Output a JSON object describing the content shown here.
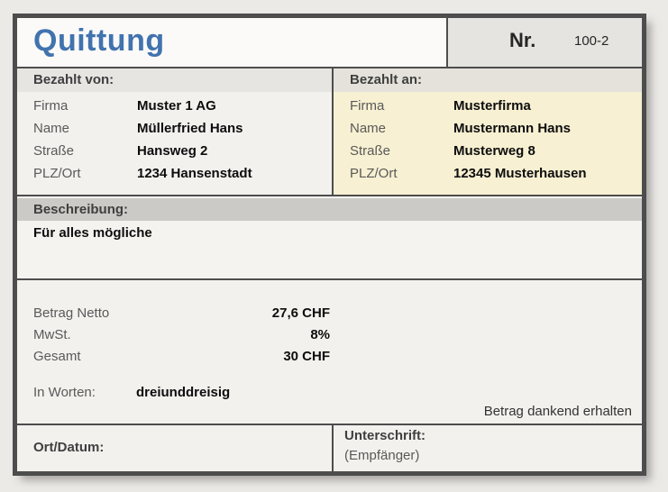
{
  "title": "Quittung",
  "number": {
    "label": "Nr.",
    "value": "100-2"
  },
  "paid_from": {
    "header": "Bezahlt von:",
    "fields": [
      {
        "label": "Firma",
        "value": "Muster 1 AG"
      },
      {
        "label": "Name",
        "value": "Müllerfried Hans"
      },
      {
        "label": "Straße",
        "value": "Hansweg 2"
      },
      {
        "label": "PLZ/Ort",
        "value": "1234 Hansenstadt"
      }
    ]
  },
  "paid_to": {
    "header": "Bezahlt an:",
    "fields": [
      {
        "label": "Firma",
        "value": "Musterfirma"
      },
      {
        "label": "Name",
        "value": "Mustermann Hans"
      },
      {
        "label": "Straße",
        "value": "Musterweg 8"
      },
      {
        "label": "PLZ/Ort",
        "value": "12345 Musterhausen"
      }
    ]
  },
  "description": {
    "header": "Beschreibung:",
    "text": "Für alles mögliche"
  },
  "amounts": {
    "net": {
      "label": "Betrag Netto",
      "value": "27,6 CHF"
    },
    "vat": {
      "label": "MwSt.",
      "value": "8%"
    },
    "total": {
      "label": "Gesamt",
      "value": "30 CHF"
    },
    "in_words": {
      "label": "In Worten:",
      "value": "dreiunddreisig"
    },
    "thanks_note": "Betrag dankend erhalten"
  },
  "footer": {
    "place_date_label": "Ort/Datum:",
    "signature_label": "Unterschrift:",
    "signature_sub": "(Empfänger)"
  },
  "colors": {
    "title_blue": "#4173ae",
    "frame": "#4d4d4d",
    "paid_to_background": "#f7f0d2",
    "strip_gray": "#cccac6",
    "page_background": "#eceae7"
  }
}
